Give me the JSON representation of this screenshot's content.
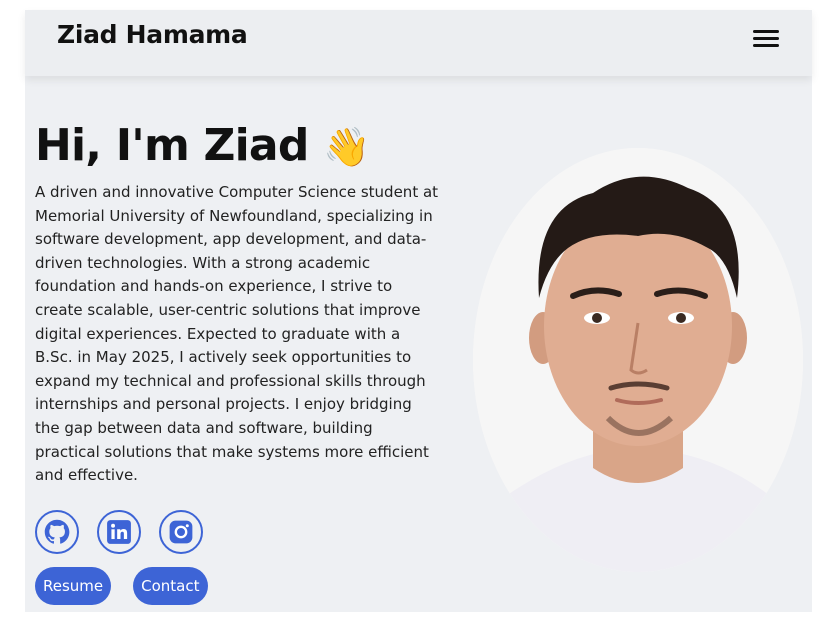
{
  "navbar": {
    "brand": "Ziad Hamama",
    "menu_icon": "hamburger-menu-icon"
  },
  "hero": {
    "title": "Hi, I'm Ziad",
    "wave_emoji": "👋",
    "bio": "A driven and innovative Computer Science student at Memorial University of Newfoundland, specializing in software development, app development, and data-driven technologies. With a strong academic foundation and hands-on experience, I strive to create scalable, user-centric solutions that improve digital experiences. Expected to graduate with a B.Sc. in May 2025, I actively seek opportunities to expand my technical and professional skills through internships and personal projects. I enjoy bridging the gap between data and software, building practical solutions that make systems more efficient and effective."
  },
  "socials": [
    {
      "icon": "github-icon"
    },
    {
      "icon": "linkedin-icon"
    },
    {
      "icon": "instagram-icon"
    }
  ],
  "buttons": {
    "resume": "Resume",
    "contact": "Contact"
  },
  "colors": {
    "accent": "#3d64d6",
    "background": "#eef0f3",
    "text": "#111111"
  }
}
